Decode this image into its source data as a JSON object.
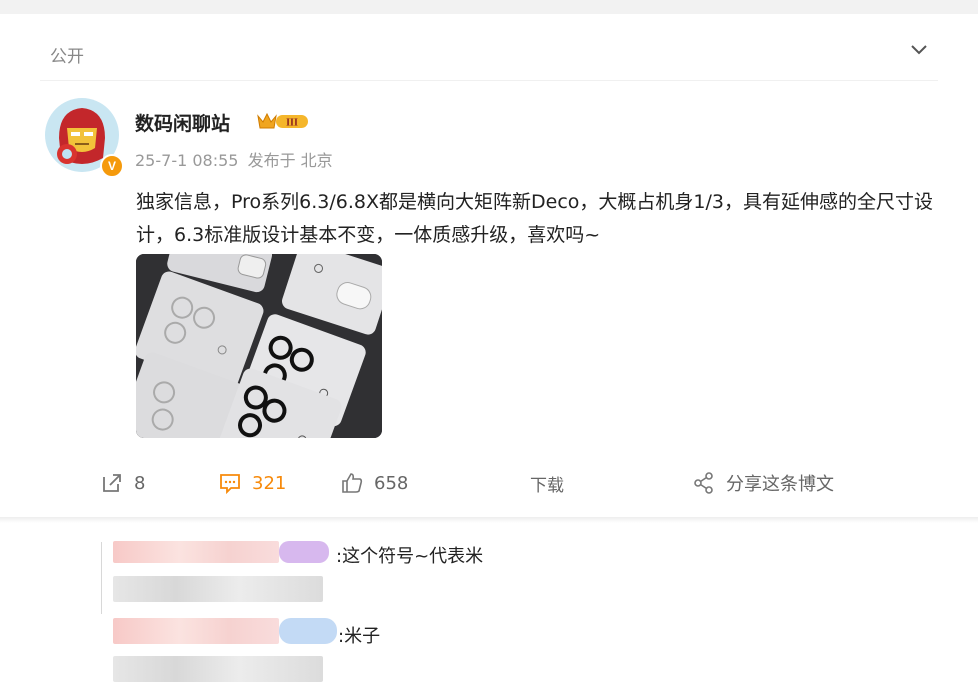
{
  "post": {
    "visibility": "公开",
    "author": "数码闲聊站",
    "level_badge": "III",
    "date": "25-7-1 08:55",
    "source": "发布于 北京",
    "text": "独家信息，Pro系列6.3/6.8X都是横向大矩阵新Deco，大概占机身1/3，具有延伸感的全尺寸设计，6.3标准版设计基本不变，一体质感升级，喜欢吗~",
    "verified_icon": "verified-v-icon"
  },
  "actions": {
    "repost_count": "8",
    "comment_count": "321",
    "like_count": "658",
    "download_label": "下载",
    "share_label": "分享这条博文"
  },
  "comments": [
    {
      "text": ":这个符号~代表米"
    },
    {
      "text": ":米子"
    }
  ],
  "colors": {
    "accent": "#f78a0b",
    "text": "#222222",
    "muted": "#999999"
  }
}
